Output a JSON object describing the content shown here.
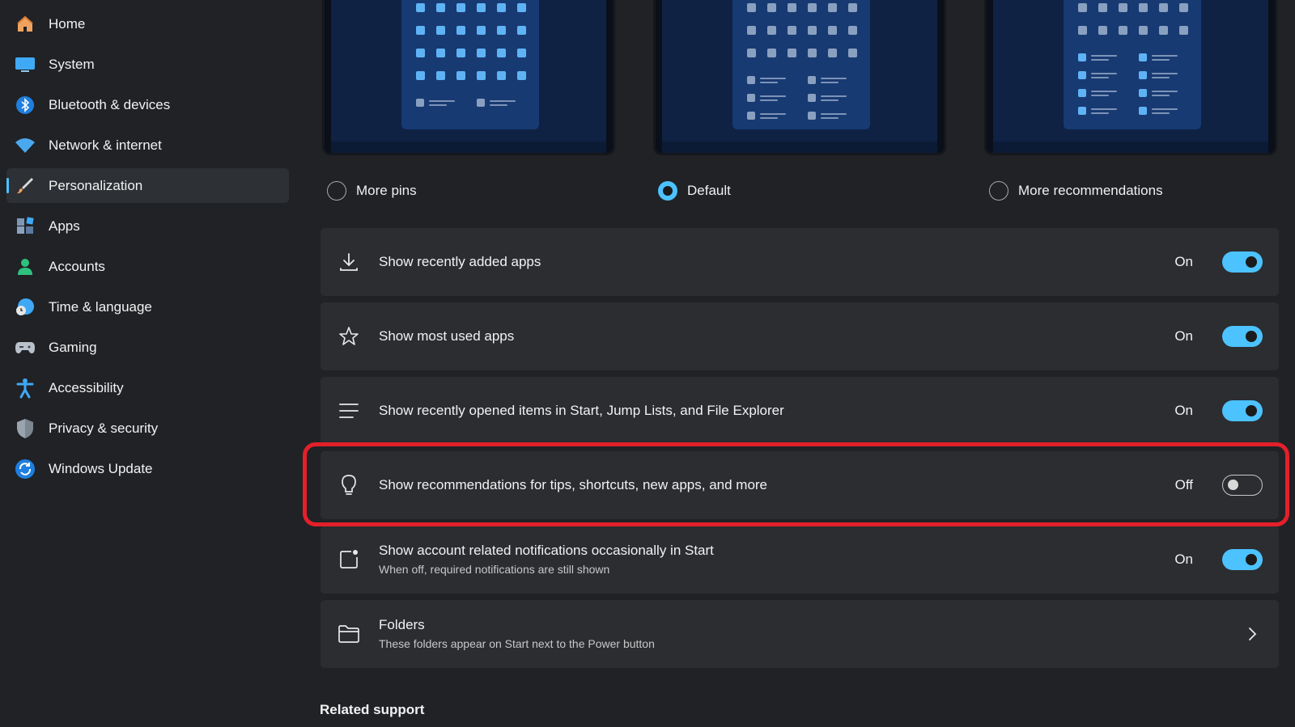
{
  "sidebar": {
    "items": [
      {
        "label": "Home"
      },
      {
        "label": "System"
      },
      {
        "label": "Bluetooth & devices"
      },
      {
        "label": "Network & internet"
      },
      {
        "label": "Personalization"
      },
      {
        "label": "Apps"
      },
      {
        "label": "Accounts"
      },
      {
        "label": "Time & language"
      },
      {
        "label": "Gaming"
      },
      {
        "label": "Accessibility"
      },
      {
        "label": "Privacy & security"
      },
      {
        "label": "Windows Update"
      }
    ],
    "active": "Personalization"
  },
  "layout_options": [
    {
      "label": "More pins",
      "selected": false
    },
    {
      "label": "Default",
      "selected": true
    },
    {
      "label": "More recommendations",
      "selected": false
    }
  ],
  "settings": [
    {
      "title": "Show recently added apps",
      "state": "On",
      "icon": "download-icon"
    },
    {
      "title": "Show most used apps",
      "state": "On",
      "icon": "star-icon"
    },
    {
      "title": "Show recently opened items in Start, Jump Lists, and File Explorer",
      "state": "On",
      "icon": "list-icon"
    },
    {
      "title": "Show recommendations for tips, shortcuts, new apps, and more",
      "state": "Off",
      "icon": "lightbulb-icon"
    },
    {
      "title": "Show account related notifications occasionally in Start",
      "subtitle": "When off, required notifications are still shown",
      "state": "On",
      "icon": "notification-icon"
    },
    {
      "title": "Folders",
      "subtitle": "These folders appear on Start next to the Power button",
      "icon": "folder-icon"
    }
  ],
  "related_support": {
    "title": "Related support"
  },
  "colors": {
    "accent": "#4cc2ff",
    "highlight": "#e3202a",
    "background": "#202226",
    "card": "#2b2d31"
  }
}
